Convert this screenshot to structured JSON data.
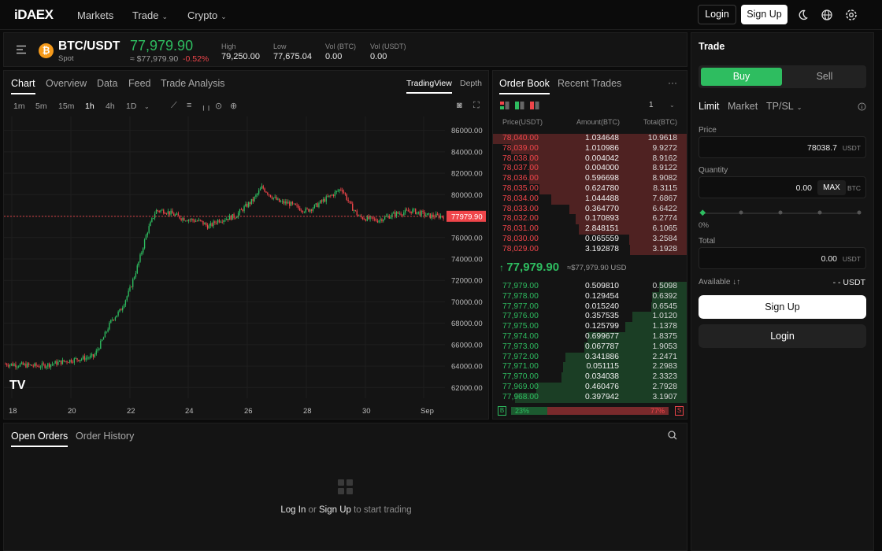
{
  "brand": {
    "logo": "iDAEX"
  },
  "nav": {
    "items": [
      "Markets",
      "Trade",
      "Crypto"
    ],
    "login": "Login",
    "signup": "Sign Up"
  },
  "ticker": {
    "pair": "BTC/USDT",
    "type": "Spot",
    "price": "77,979.90",
    "approx": "≈ $77,979.90",
    "change": "-0.52%",
    "stats": [
      {
        "label": "High",
        "value": "79,250.00"
      },
      {
        "label": "Low",
        "value": "77,675.04"
      },
      {
        "label": "Vol (BTC)",
        "value": "0.00"
      },
      {
        "label": "Vol (USDT)",
        "value": "0.00"
      }
    ]
  },
  "chart_panel": {
    "tabs": [
      "Chart",
      "Overview",
      "Data",
      "Feed",
      "Trade Analysis"
    ],
    "view_tabs": [
      "TradingView",
      "Depth"
    ],
    "intervals": [
      "1m",
      "5m",
      "15m",
      "1h",
      "4h",
      "1D"
    ],
    "selected_interval": "1h",
    "logo": "TV"
  },
  "chart_data": {
    "type": "candlestick",
    "x_ticks": [
      "18",
      "20",
      "22",
      "24",
      "26",
      "28",
      "30",
      "Sep"
    ],
    "y_ticks": [
      "86000.00",
      "84000.00",
      "82000.00",
      "80000.00",
      "78000.00",
      "76000.00",
      "74000.00",
      "72000.00",
      "70000.00",
      "68000.00",
      "66000.00",
      "64000.00",
      "62000.00"
    ],
    "ylim": [
      61000,
      87000
    ],
    "last_price": "77979.90",
    "last_price_value": 77979.9,
    "trend": [
      [
        0,
        64200
      ],
      [
        8,
        64000
      ],
      [
        14,
        64500
      ],
      [
        20,
        64900
      ],
      [
        22,
        66500
      ],
      [
        24,
        68300
      ],
      [
        26,
        69200
      ],
      [
        28,
        71000
      ],
      [
        30,
        73500
      ],
      [
        32,
        76500
      ],
      [
        33,
        77500
      ],
      [
        34,
        78500
      ],
      [
        36,
        78500
      ],
      [
        40,
        77800
      ],
      [
        44,
        77500
      ],
      [
        46,
        77000
      ],
      [
        48,
        77600
      ],
      [
        52,
        78000
      ],
      [
        54,
        78800
      ],
      [
        56,
        79500
      ],
      [
        58,
        80700
      ],
      [
        60,
        79900
      ],
      [
        62,
        79300
      ],
      [
        64,
        79200
      ],
      [
        66,
        78800
      ],
      [
        68,
        78500
      ],
      [
        70,
        78900
      ],
      [
        72,
        79500
      ],
      [
        74,
        80000
      ],
      [
        76,
        80600
      ],
      [
        78,
        79000
      ],
      [
        80,
        77900
      ],
      [
        84,
        77600
      ],
      [
        88,
        78200
      ],
      [
        92,
        78500
      ],
      [
        96,
        78000
      ],
      [
        99,
        78000
      ]
    ]
  },
  "order_book": {
    "tabs": [
      "Order Book",
      "Recent Trades"
    ],
    "precision": "1",
    "headers": [
      "Price(USDT)",
      "Amount(BTC)",
      "Total(BTC)"
    ],
    "asks": [
      [
        "78,040.00",
        "1.034648",
        "10.9618"
      ],
      [
        "78,039.00",
        "1.010986",
        "9.9272"
      ],
      [
        "78,038.00",
        "0.004042",
        "8.9162"
      ],
      [
        "78,037.00",
        "0.004000",
        "8.9122"
      ],
      [
        "78,036.00",
        "0.596698",
        "8.9082"
      ],
      [
        "78,035.00",
        "0.624780",
        "8.3115"
      ],
      [
        "78,034.00",
        "1.044488",
        "7.6867"
      ],
      [
        "78,033.00",
        "0.364770",
        "6.6422"
      ],
      [
        "78,032.00",
        "0.170893",
        "6.2774"
      ],
      [
        "78,031.00",
        "2.848151",
        "6.1065"
      ],
      [
        "78,030.00",
        "0.065559",
        "3.2584"
      ],
      [
        "78,029.00",
        "3.192878",
        "3.1928"
      ]
    ],
    "mid_price": "77,979.90",
    "mid_usd": "≈$77,979.90 USD",
    "bids": [
      [
        "77,979.00",
        "0.509810",
        "0.5098"
      ],
      [
        "77,978.00",
        "0.129454",
        "0.6392"
      ],
      [
        "77,977.00",
        "0.015240",
        "0.6545"
      ],
      [
        "77,976.00",
        "0.357535",
        "1.0120"
      ],
      [
        "77,975.00",
        "0.125799",
        "1.1378"
      ],
      [
        "77,974.00",
        "0.699677",
        "1.8375"
      ],
      [
        "77,973.00",
        "0.067787",
        "1.9053"
      ],
      [
        "77,972.00",
        "0.341886",
        "2.2471"
      ],
      [
        "77,971.00",
        "0.051115",
        "2.2983"
      ],
      [
        "77,970.00",
        "0.034038",
        "2.3323"
      ],
      [
        "77,969.00",
        "0.460476",
        "2.7928"
      ],
      [
        "77,968.00",
        "0.397942",
        "3.1907"
      ]
    ],
    "buy_ratio": "23%",
    "sell_ratio": "77%",
    "buy_ratio_value": 23,
    "b_label": "B",
    "s_label": "S"
  },
  "orders": {
    "tabs": [
      "Open Orders",
      "Order History"
    ],
    "empty": {
      "login": "Log In",
      "or": " or ",
      "signup": "Sign Up",
      "rest": " to start trading"
    }
  },
  "trade": {
    "title": "Trade",
    "buy": "Buy",
    "sell": "Sell",
    "order_types": [
      "Limit",
      "Market",
      "TP/SL"
    ],
    "price_label": "Price",
    "price_value": "78038.7",
    "price_unit": "USDT",
    "qty_label": "Quantity",
    "qty_value": "0.00",
    "qty_max": "MAX",
    "qty_unit": "BTC",
    "slider_pct": "0%",
    "total_label": "Total",
    "total_value": "0.00",
    "total_unit": "USDT",
    "available_label": "Available ↓↑",
    "available_value": "- - USDT",
    "signup": "Sign Up",
    "login": "Login"
  },
  "colors": {
    "up": "#2ebd60",
    "down": "#ef454a",
    "accent": "#f59a1b"
  }
}
